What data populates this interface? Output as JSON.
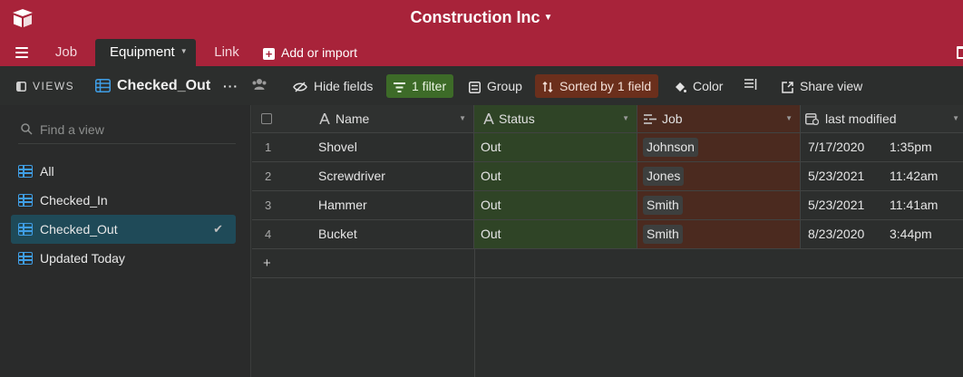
{
  "base": {
    "title": "Construction Inc"
  },
  "tabs": [
    {
      "label": "Job"
    },
    {
      "label": "Equipment"
    },
    {
      "label": "Link"
    }
  ],
  "add_import": {
    "label": "Add or import"
  },
  "viewbar": {
    "views_label": "VIEWS",
    "current_view": "Checked_Out",
    "more": "···",
    "hide_fields": "Hide fields",
    "filter": "1 filter",
    "group": "Group",
    "sort": "Sorted by 1 field",
    "color": "Color",
    "share": "Share view"
  },
  "sidebar": {
    "search_placeholder": "Find a view",
    "views": [
      {
        "label": "All"
      },
      {
        "label": "Checked_In"
      },
      {
        "label": "Checked_Out",
        "selected": true
      },
      {
        "label": "Updated Today"
      }
    ]
  },
  "grid": {
    "columns": [
      "Name",
      "Status",
      "Job",
      "last modified"
    ],
    "rows": [
      {
        "num": "1",
        "name": "Shovel",
        "status": "Out",
        "job": "Johnson",
        "date": "7/17/2020",
        "time": "1:35pm"
      },
      {
        "num": "2",
        "name": "Screwdriver",
        "status": "Out",
        "job": "Jones",
        "date": "5/23/2021",
        "time": "11:42am"
      },
      {
        "num": "3",
        "name": "Hammer",
        "status": "Out",
        "job": "Smith",
        "date": "5/23/2021",
        "time": "11:41am"
      },
      {
        "num": "4",
        "name": "Bucket",
        "status": "Out",
        "job": "Smith",
        "date": "8/23/2020",
        "time": "3:44pm"
      }
    ],
    "add_row": "+"
  },
  "colors": {
    "topbar": "#a8233a",
    "filter": "#3d6b28",
    "sort": "#6b2f1c",
    "status_col": "#2f4426",
    "job_col": "#4b2a1f",
    "selected_view": "#1f4a58",
    "icon_blue": "#3f9ee6"
  }
}
